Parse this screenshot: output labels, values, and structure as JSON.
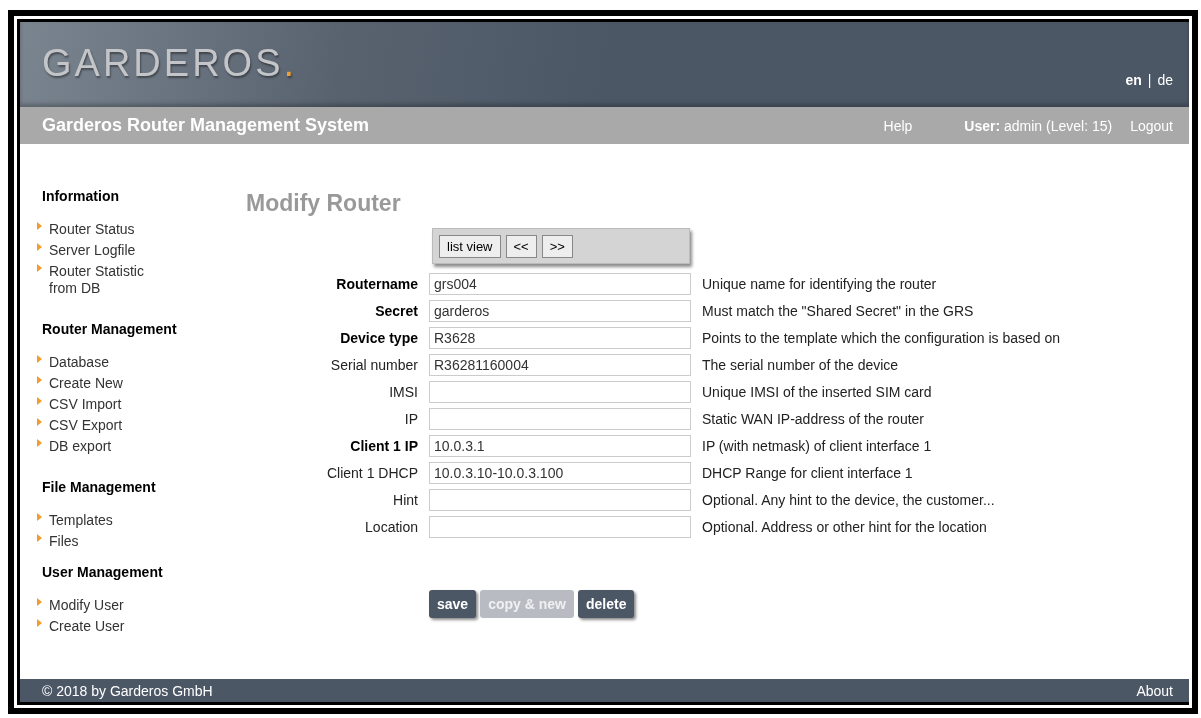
{
  "header": {
    "logo": "GARDEROS.",
    "languages": [
      {
        "label": "en",
        "selected": true
      },
      {
        "label": "de",
        "selected": false
      }
    ],
    "separator": "|"
  },
  "title_bar": {
    "title": "Garderos Router Management System",
    "help": "Help",
    "user_label": "User:",
    "user_value": "admin (Level: 15)",
    "logout": "Logout"
  },
  "sidebar": [
    {
      "heading": "Information",
      "items": [
        "Router Status",
        "Server Logfile",
        "Router Statistic from DB"
      ]
    },
    {
      "heading": "Router Management",
      "items": [
        "Database",
        "Create New",
        "CSV Import",
        "CSV Export",
        "DB export"
      ]
    },
    {
      "heading": "File Management",
      "items": [
        "Templates",
        "Files"
      ]
    },
    {
      "heading": "User Management",
      "items": [
        "Modify User",
        "Create User"
      ]
    }
  ],
  "page_title": "Modify Router",
  "nav_buttons": [
    "list view",
    "<<",
    ">>"
  ],
  "fields": [
    {
      "label": "Routername",
      "required": true,
      "value": "grs004",
      "help": "Unique name for identifying the router"
    },
    {
      "label": "Secret",
      "required": true,
      "value": "garderos",
      "help": "Must match the \"Shared Secret\" in the GRS"
    },
    {
      "label": "Device type",
      "required": true,
      "value": "R3628",
      "help": "Points to the template which the configuration is based on"
    },
    {
      "label": "Serial number",
      "required": false,
      "value": "R36281160004",
      "help": "The serial number of the device"
    },
    {
      "label": "IMSI",
      "required": false,
      "help": "Unique IMSI of the inserted SIM card"
    },
    {
      "label": "IP",
      "required": false,
      "help": "Static WAN IP-address of the router"
    },
    {
      "label": "Client 1 IP",
      "required": true,
      "value": "10.0.3.1",
      "help": "IP (with netmask) of client interface 1"
    },
    {
      "label": "Client 1 DHCP",
      "required": false,
      "value": "10.0.3.10-10.0.3.100",
      "help": "DHCP Range for client interface 1"
    },
    {
      "label": "Hint",
      "required": false,
      "help": "Optional. Any hint to the device, the customer..."
    },
    {
      "label": "Location",
      "required": false,
      "help": "Optional. Address or other hint for the location"
    }
  ],
  "actions": [
    {
      "label": "save",
      "disabled": false
    },
    {
      "label": "copy & new",
      "disabled": true
    },
    {
      "label": "delete",
      "disabled": false
    }
  ],
  "footer": {
    "copyright": "© 2018 by Garderos GmbH",
    "about": "About"
  }
}
